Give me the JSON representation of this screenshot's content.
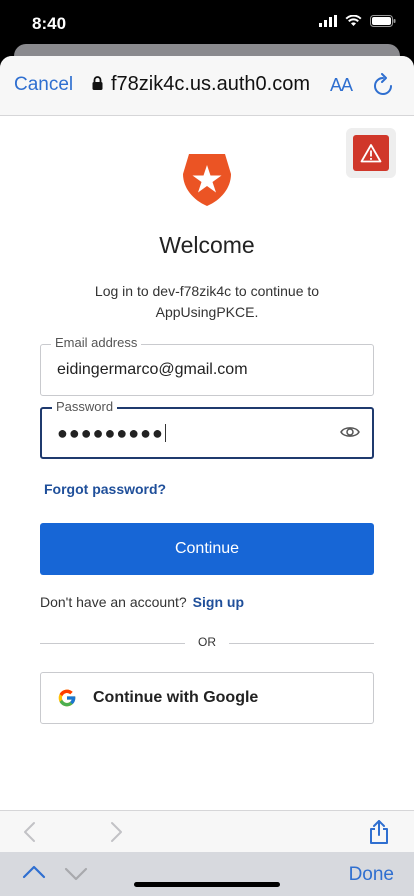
{
  "status": {
    "time": "8:40"
  },
  "nav": {
    "cancel_label": "Cancel",
    "url": "f78zik4c.us.auth0.com",
    "text_size_label": "AA"
  },
  "login": {
    "title": "Welcome",
    "subtitle": "Log in to dev-f78zik4c to continue to AppUsingPKCE.",
    "email_label": "Email address",
    "email_value": "eidingermarco@gmail.com",
    "password_label": "Password",
    "password_value": "●●●●●●●●●",
    "forgot_label": "Forgot password?",
    "continue_label": "Continue",
    "no_account_text": "Don't have an account?",
    "signup_label": "Sign up",
    "or_label": "OR",
    "google_label": "Continue with Google"
  },
  "keyboard_bar": {
    "done_label": "Done"
  },
  "colors": {
    "accent": "#1766d6",
    "ios_blue": "#2f6fd0",
    "alert_red": "#d0372a",
    "auth0_red": "#eb5424"
  }
}
